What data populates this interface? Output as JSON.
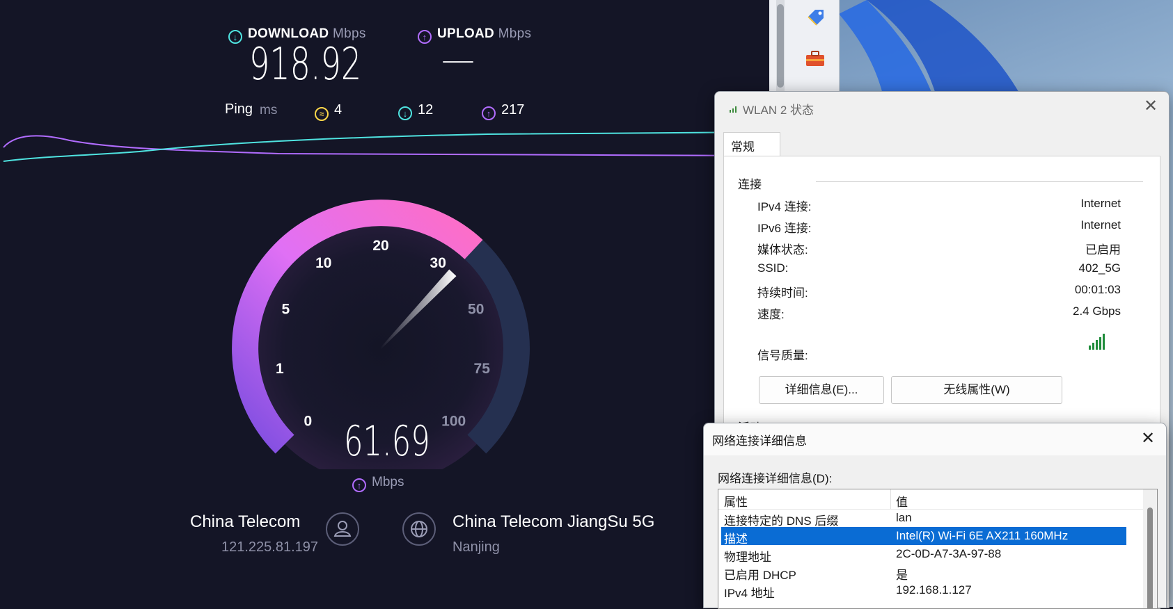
{
  "speedtest": {
    "download": {
      "label": "DOWNLOAD",
      "unit": "Mbps",
      "value": "918.92"
    },
    "upload": {
      "label": "UPLOAD",
      "unit": "Mbps",
      "value": "—"
    },
    "ping": {
      "label": "Ping",
      "unit": "ms",
      "idle": "4",
      "down": "12",
      "up": "217"
    },
    "gauge": {
      "ticks": [
        "0",
        "1",
        "5",
        "10",
        "20",
        "30",
        "50",
        "75",
        "100"
      ],
      "current_value": "61.69",
      "unit": "Mbps",
      "needle_fraction": 0.66
    },
    "isp": {
      "name": "China Telecom",
      "ip": "121.225.81.197"
    },
    "server": {
      "name": "China Telecom JiangSu 5G",
      "location": "Nanjing"
    },
    "colors": {
      "download": "#4fe3e0",
      "upload": "#b16cff",
      "ping": "#ffd84a",
      "gauge_start": "#8a5cf0",
      "gauge_end": "#ff6ec4"
    }
  },
  "wlan_status": {
    "title": "WLAN 2 状态",
    "tab": "常规",
    "section": "连接",
    "rows": [
      {
        "label": "IPv4 连接:",
        "value": "Internet"
      },
      {
        "label": "IPv6 连接:",
        "value": "Internet"
      },
      {
        "label": "媒体状态:",
        "value": "已启用"
      },
      {
        "label": "SSID:",
        "value": "402_5G"
      },
      {
        "label": "持续时间:",
        "value": "00:01:03"
      },
      {
        "label": "速度:",
        "value": "2.4 Gbps"
      }
    ],
    "signal_label": "信号质量:",
    "details_button": "详细信息(E)...",
    "wireless_button": "无线属性(W)",
    "activity_partial": "活动"
  },
  "net_details": {
    "title": "网络连接详细信息",
    "caption": "网络连接详细信息(D):",
    "columns": [
      "属性",
      "值"
    ],
    "rows": [
      {
        "property": "连接特定的 DNS 后缀",
        "value": "lan"
      },
      {
        "property": "描述",
        "value": "Intel(R) Wi-Fi 6E AX211 160MHz"
      },
      {
        "property": "物理地址",
        "value": "2C-0D-A7-3A-97-88"
      },
      {
        "property": "已启用 DHCP",
        "value": "是"
      },
      {
        "property": "IPv4 地址",
        "value": "192.168.1.127"
      }
    ],
    "selected_index": 1
  }
}
